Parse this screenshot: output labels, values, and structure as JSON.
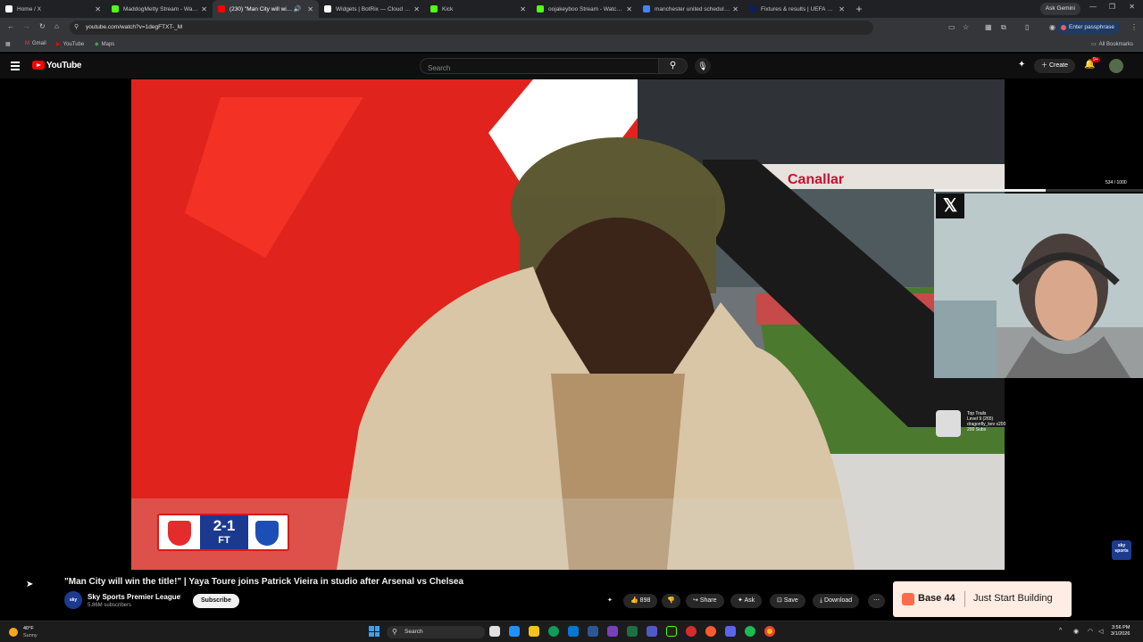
{
  "browser": {
    "tabs": [
      {
        "title": "Home / X",
        "icon": "x-logo-icon",
        "color": "#ffffff",
        "active": false
      },
      {
        "title": "MaddogMetty Stream - Watch",
        "icon": "kick-icon",
        "color": "#53fc18",
        "active": false
      },
      {
        "title": "(230) \"Man City will win th",
        "icon": "youtube-icon",
        "color": "#ff0000",
        "active": true
      },
      {
        "title": "Widgets | BotRix — Cloud Strea",
        "icon": "botrix-icon",
        "color": "#ffffff",
        "active": false
      },
      {
        "title": "Kick",
        "icon": "kick-icon",
        "color": "#53fc18",
        "active": false
      },
      {
        "title": "oojakeyboo Stream - Watch Liv",
        "icon": "kick-icon",
        "color": "#53fc18",
        "active": false
      },
      {
        "title": "manchester united schedule - G",
        "icon": "google-icon",
        "color": "#4285f4",
        "active": false
      },
      {
        "title": "Fixtures & results | UEFA Cham",
        "icon": "uefa-icon",
        "color": "#0e1e5b",
        "active": false
      }
    ],
    "ask_gemini": "Ask Gemini",
    "url": "youtube.com/watch?v=1degFTXT-_M",
    "passphrase_label": "Enter passphrase",
    "bookmarks": [
      "Gmail",
      "YouTube",
      "Maps"
    ],
    "all_bookmarks": "All Bookmarks"
  },
  "youtube": {
    "brand": "YouTube",
    "search_placeholder": "Search",
    "create_label": "Create",
    "notif_count": "9+",
    "accent": "#ff0000"
  },
  "video": {
    "scoreboard": {
      "score": "2-1",
      "status": "FT",
      "home_team": "Arsenal",
      "away_team": "Chelsea"
    },
    "overlay": {
      "counter": "534 / 1000",
      "progress": 0.534,
      "train_lines": [
        "Top Trails",
        "Level 9 (265)",
        "dragonfly_kev x200",
        "200 Subs"
      ]
    },
    "sky_bug": "sky sports"
  },
  "watch": {
    "title": "\"Man City will win the title!\" | Yaya Toure joins Patrick Vieira in studio after Arsenal vs Chelsea",
    "channel": "Sky Sports Premier League",
    "subscribers": "5.86M subscribers",
    "subscribe_label": "Subscribe",
    "likes": "898",
    "share_label": "Share",
    "ask_label": "Ask",
    "save_label": "Save",
    "download_label": "Download"
  },
  "ad": {
    "brand": "Base 44",
    "tagline": "Just Start Building"
  },
  "taskbar": {
    "weather_temp": "40°F",
    "weather_cond": "Sunny",
    "search_placeholder": "Search",
    "time": "3:56 PM",
    "date": "3/1/2026"
  }
}
